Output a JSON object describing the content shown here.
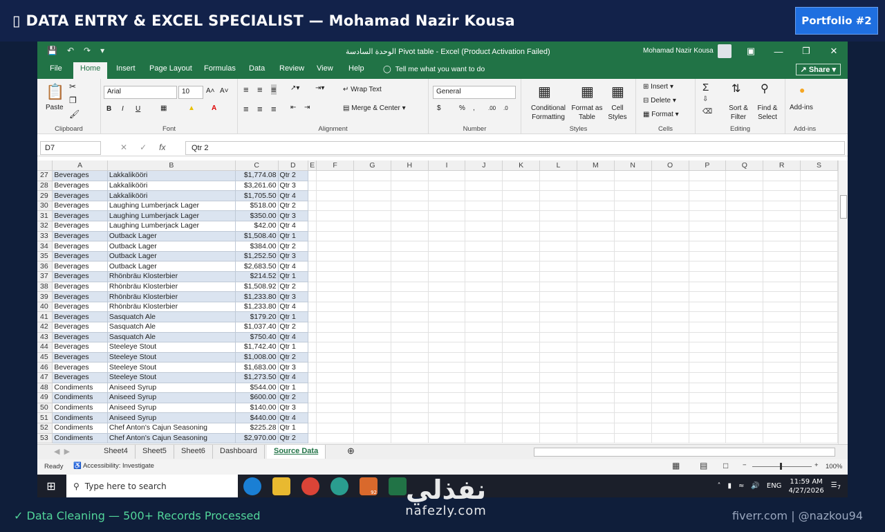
{
  "banner": {
    "icon": "▯",
    "title": "DATA ENTRY & EXCEL SPECIALIST — Mohamad Nazir Kousa",
    "badge": "Portfolio #2"
  },
  "excel": {
    "title": "الوحدة السادسة Pivot table  -  Excel (Product Activation Failed)",
    "user": "Mohamad Nazir Kousa",
    "tabs": [
      "File",
      "Home",
      "Insert",
      "Page Layout",
      "Formulas",
      "Data",
      "Review",
      "View",
      "Help"
    ],
    "tell_me": "Tell me what you want to do",
    "share": "Share",
    "ribbon": {
      "clipboard": {
        "paste": "Paste",
        "label": "Clipboard"
      },
      "font": {
        "name": "Arial",
        "size": "10",
        "bold": "B",
        "italic": "I",
        "underline": "U",
        "label": "Font"
      },
      "alignment": {
        "wrap": "Wrap Text",
        "merge": "Merge & Center",
        "label": "Alignment"
      },
      "number": {
        "format": "General",
        "currency": "$",
        "percent": "%",
        "comma": ",",
        "label": "Number"
      },
      "styles": {
        "conditional": "Conditional Formatting",
        "format_table": "Format as Table",
        "cell_styles": "Cell Styles",
        "label": "Styles"
      },
      "cells": {
        "insert": "Insert",
        "delete": "Delete",
        "format": "Format",
        "label": "Cells"
      },
      "editing": {
        "sort": "Sort & Filter",
        "find": "Find & Select",
        "label": "Editing"
      },
      "addins": {
        "addins": "Add-ins",
        "label": "Add-ins"
      }
    },
    "namebox": "D7",
    "formula": "Qtr 2",
    "columns": [
      "A",
      "B",
      "C",
      "D",
      "E",
      "F",
      "G",
      "H",
      "I",
      "J",
      "K",
      "L",
      "M",
      "N",
      "O",
      "P",
      "Q",
      "R",
      "S"
    ],
    "rows": [
      [
        "27",
        "Beverages",
        "Lakkalikööri",
        "$1,774.08",
        "Qtr 2"
      ],
      [
        "28",
        "Beverages",
        "Lakkalikööri",
        "$3,261.60",
        "Qtr 3"
      ],
      [
        "29",
        "Beverages",
        "Lakkalikööri",
        "$1,705.50",
        "Qtr 4"
      ],
      [
        "30",
        "Beverages",
        "Laughing Lumberjack Lager",
        "$518.00",
        "Qtr 2"
      ],
      [
        "31",
        "Beverages",
        "Laughing Lumberjack Lager",
        "$350.00",
        "Qtr 3"
      ],
      [
        "32",
        "Beverages",
        "Laughing Lumberjack Lager",
        "$42.00",
        "Qtr 4"
      ],
      [
        "33",
        "Beverages",
        "Outback Lager",
        "$1,508.40",
        "Qtr 1"
      ],
      [
        "34",
        "Beverages",
        "Outback Lager",
        "$384.00",
        "Qtr 2"
      ],
      [
        "35",
        "Beverages",
        "Outback Lager",
        "$1,252.50",
        "Qtr 3"
      ],
      [
        "36",
        "Beverages",
        "Outback Lager",
        "$2,683.50",
        "Qtr 4"
      ],
      [
        "37",
        "Beverages",
        "Rhönbräu Klosterbier",
        "$214.52",
        "Qtr 1"
      ],
      [
        "38",
        "Beverages",
        "Rhönbräu Klosterbier",
        "$1,508.92",
        "Qtr 2"
      ],
      [
        "39",
        "Beverages",
        "Rhönbräu Klosterbier",
        "$1,233.80",
        "Qtr 3"
      ],
      [
        "40",
        "Beverages",
        "Rhönbräu Klosterbier",
        "$1,233.80",
        "Qtr 4"
      ],
      [
        "41",
        "Beverages",
        "Sasquatch Ale",
        "$179.20",
        "Qtr 1"
      ],
      [
        "42",
        "Beverages",
        "Sasquatch Ale",
        "$1,037.40",
        "Qtr 2"
      ],
      [
        "43",
        "Beverages",
        "Sasquatch Ale",
        "$750.40",
        "Qtr 4"
      ],
      [
        "44",
        "Beverages",
        "Steeleye Stout",
        "$1,742.40",
        "Qtr 1"
      ],
      [
        "45",
        "Beverages",
        "Steeleye Stout",
        "$1,008.00",
        "Qtr 2"
      ],
      [
        "46",
        "Beverages",
        "Steeleye Stout",
        "$1,683.00",
        "Qtr 3"
      ],
      [
        "47",
        "Beverages",
        "Steeleye Stout",
        "$1,273.50",
        "Qtr 4"
      ],
      [
        "48",
        "Condiments",
        "Aniseed Syrup",
        "$544.00",
        "Qtr 1"
      ],
      [
        "49",
        "Condiments",
        "Aniseed Syrup",
        "$600.00",
        "Qtr 2"
      ],
      [
        "50",
        "Condiments",
        "Aniseed Syrup",
        "$140.00",
        "Qtr 3"
      ],
      [
        "51",
        "Condiments",
        "Aniseed Syrup",
        "$440.00",
        "Qtr 4"
      ],
      [
        "52",
        "Condiments",
        "Chef Anton's Cajun Seasoning",
        "$225.28",
        "Qtr 1"
      ],
      [
        "53",
        "Condiments",
        "Chef Anton's Cajun Seasoning",
        "$2,970.00",
        "Qtr 2"
      ]
    ],
    "sheets": [
      "Sheet4",
      "Sheet5",
      "Sheet6",
      "Dashboard",
      "Source Data"
    ],
    "active_sheet": "Source Data",
    "status": {
      "ready": "Ready",
      "accessibility": "Accessibility: Investigate",
      "zoom": "100%"
    }
  },
  "taskbar": {
    "search_placeholder": "Type here to search",
    "lang": "ENG",
    "time": "11:59 AM",
    "date": "4/27/2026",
    "telegram_badge": "92",
    "notifications": "7"
  },
  "footer": {
    "left": "✓ Data Cleaning — 500+ Records Processed",
    "right": "fiverr.com | @nazkou94"
  },
  "watermark": {
    "arabic": "نفذلي",
    "latin": "nafezly.com"
  },
  "colors": {
    "excel_green": "#217346",
    "banner_bg": "#12224a",
    "badge_blue": "#1f6fe0",
    "footer_green": "#52d59a",
    "row_band": "#dbe4f0"
  }
}
